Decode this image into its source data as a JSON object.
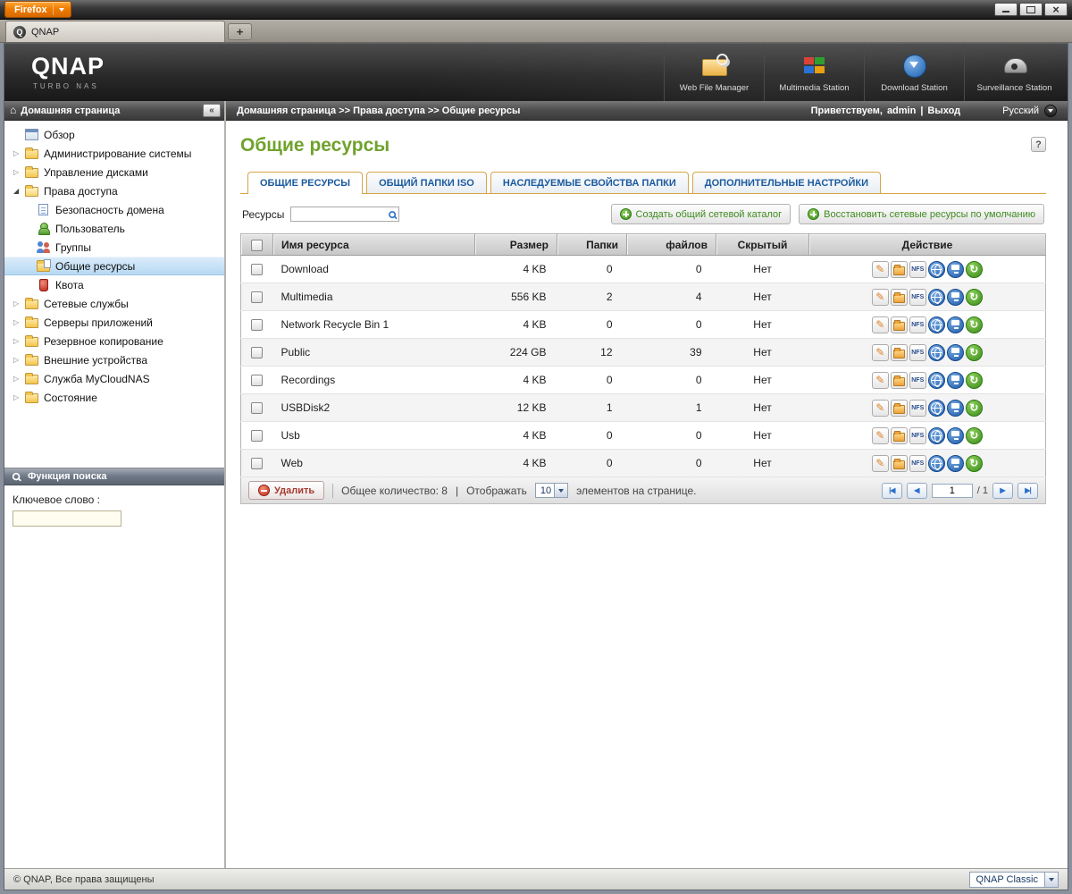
{
  "browser": {
    "firefox_button_label": "Firefox",
    "tab_title": "QNAP",
    "new_tab_label": "+"
  },
  "header": {
    "logo": "QNAP",
    "logo_sub": "Turbo NAS",
    "stations": [
      {
        "label": "Web File Manager"
      },
      {
        "label": "Multimedia Station"
      },
      {
        "label": "Download Station"
      },
      {
        "label": "Surveillance Station"
      }
    ]
  },
  "sidebar": {
    "title": "Домашняя страница",
    "collapse_glyph": "«",
    "items": [
      {
        "label": "Обзор"
      },
      {
        "label": "Администрирование системы"
      },
      {
        "label": "Управление дисками"
      },
      {
        "label": "Права доступа"
      },
      {
        "label": "Безопасность домена"
      },
      {
        "label": "Пользователь"
      },
      {
        "label": "Группы"
      },
      {
        "label": "Общие ресурсы"
      },
      {
        "label": "Квота"
      },
      {
        "label": "Сетевые службы"
      },
      {
        "label": "Серверы приложений"
      },
      {
        "label": "Резервное копирование"
      },
      {
        "label": "Внешние устройства"
      },
      {
        "label": "Служба MyCloudNAS"
      },
      {
        "label": "Состояние"
      }
    ],
    "search_title": "Функция поиска",
    "keyword_label": "Ключевое слово :",
    "keyword_value": ""
  },
  "breadcrumb": {
    "path": "Домашняя страница >> Права доступа >> Общие ресурсы",
    "welcome": "Приветствуем,",
    "user": "admin",
    "separator": "|",
    "logout": "Выход",
    "language": "Русский"
  },
  "page": {
    "title": "Общие ресурсы",
    "help_glyph": "?"
  },
  "tabs": [
    {
      "label": "ОБЩИЕ РЕСУРСЫ"
    },
    {
      "label": "ОБЩИЙ ПАПКИ ISO"
    },
    {
      "label": "НАСЛЕДУЕМЫЕ СВОЙСТВА ПАПКИ"
    },
    {
      "label": "ДОПОЛНИТЕЛЬНЫЕ НАСТРОЙКИ"
    }
  ],
  "toolbar": {
    "filter_label": "Ресурсы",
    "filter_value": "",
    "create_button": "Создать общий сетевой каталог",
    "restore_button": "Восстановить сетевые ресурсы по умолчанию"
  },
  "table": {
    "headers": {
      "name": "Имя ресурса",
      "size": "Размер",
      "folders": "Папки",
      "files": "файлов",
      "hidden": "Скрытый",
      "action": "Действие"
    },
    "nfs_label": "NFS",
    "rows": [
      {
        "name": "Download",
        "size": "4 KB",
        "folders": "0",
        "files": "0",
        "hidden": "Нет"
      },
      {
        "name": "Multimedia",
        "size": "556 KB",
        "folders": "2",
        "files": "4",
        "hidden": "Нет"
      },
      {
        "name": "Network Recycle Bin 1",
        "size": "4 KB",
        "folders": "0",
        "files": "0",
        "hidden": "Нет"
      },
      {
        "name": "Public",
        "size": "224 GB",
        "folders": "12",
        "files": "39",
        "hidden": "Нет"
      },
      {
        "name": "Recordings",
        "size": "4 KB",
        "folders": "0",
        "files": "0",
        "hidden": "Нет"
      },
      {
        "name": "USBDisk2",
        "size": "12 KB",
        "folders": "1",
        "files": "1",
        "hidden": "Нет"
      },
      {
        "name": "Usb",
        "size": "4 KB",
        "folders": "0",
        "files": "0",
        "hidden": "Нет"
      },
      {
        "name": "Web",
        "size": "4 KB",
        "folders": "0",
        "files": "0",
        "hidden": "Нет"
      }
    ]
  },
  "table_footer": {
    "delete_button": "Удалить",
    "total_label": "Общее количество: 8",
    "separator": "|",
    "display_label": "Отображать",
    "per_page_value": "10",
    "display_suffix": "элементов на странице.",
    "page_value": "1",
    "page_total": "/ 1"
  },
  "statusbar": {
    "copyright": "© QNAP, Все права защищены",
    "theme_value": "QNAP Classic"
  },
  "colors": {
    "accent_green": "#70a22d",
    "tab_text_blue": "#1b5a9e",
    "tab_border_tan": "#d8a448",
    "selection_blue": "#b5d8f2",
    "firefox_orange": "#f07d00"
  }
}
